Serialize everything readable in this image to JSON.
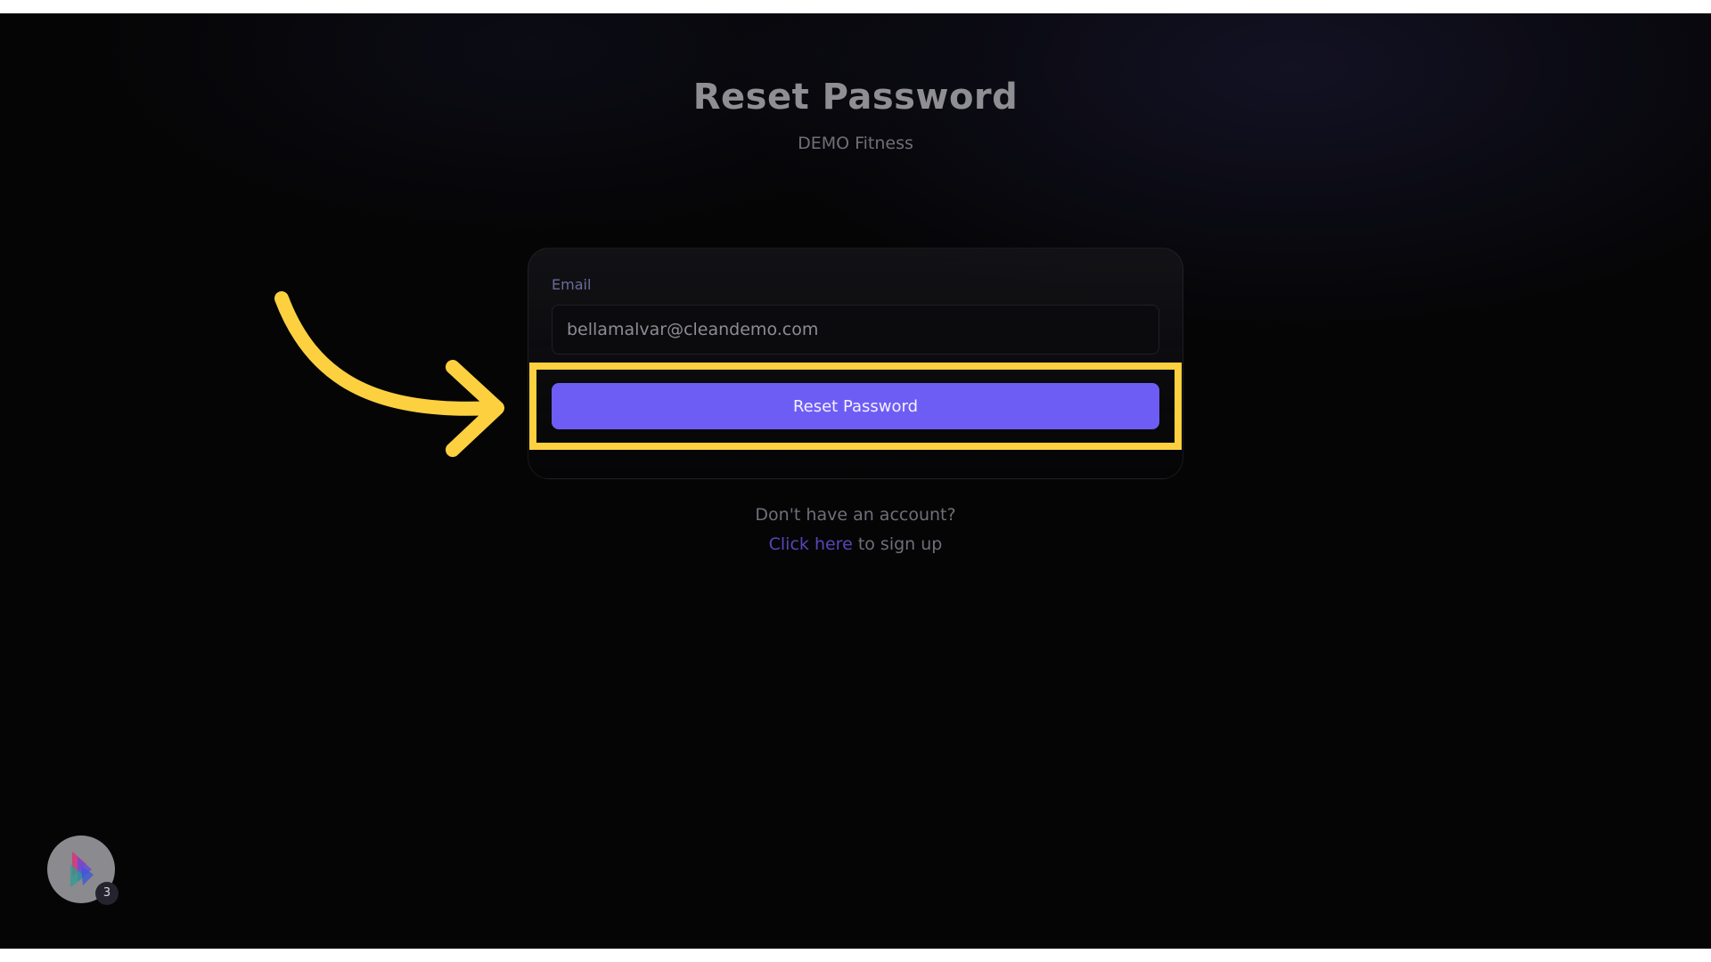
{
  "page": {
    "title": "Reset Password",
    "subtitle": "DEMO Fitness"
  },
  "form": {
    "email_label": "Email",
    "email_value": "bellamalvar@cleandemo.com",
    "submit_label": "Reset Password"
  },
  "footer": {
    "prompt": "Don't have an account?",
    "link_text": "Click here",
    "link_suffix": " to sign up"
  },
  "widget": {
    "badge_count": "3",
    "icon": "chameleon-logo-icon"
  },
  "annotation": {
    "icon": "arrow-annotation-icon",
    "highlight_color": "#fcd03f"
  },
  "colors": {
    "accent": "#6e5df4",
    "link": "#5647b8",
    "background": "#050506"
  }
}
